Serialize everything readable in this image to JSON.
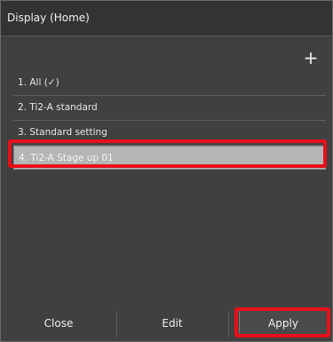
{
  "window": {
    "title": "Display (Home)"
  },
  "toolbar": {
    "add_icon": "plus-icon",
    "add_label": "+"
  },
  "list": {
    "items": [
      {
        "label": "1. All (✓)",
        "selected": false
      },
      {
        "label": "2. Ti2-A standard",
        "selected": false
      },
      {
        "label": "3. Standard setting",
        "selected": false
      },
      {
        "label": "4. Ti2-A Stage up 01",
        "selected": true
      }
    ]
  },
  "footer": {
    "close_label": "Close",
    "edit_label": "Edit",
    "apply_label": "Apply"
  },
  "colors": {
    "background": "#404040",
    "titlebar": "#333333",
    "selected_row": "#b5b5b5",
    "highlight": "#e8101a"
  }
}
